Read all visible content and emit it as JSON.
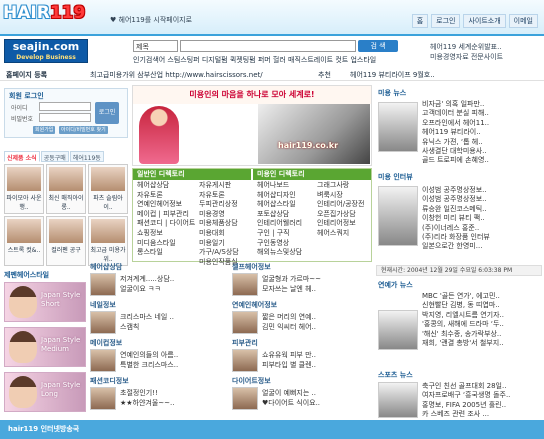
{
  "header": {
    "logo_prefix": "HAIR",
    "logo_suffix": "119",
    "start_link": "♥ 헤어119를 시작페이지로",
    "links": [
      "홈",
      "로그인",
      "사이트소개",
      "이메일"
    ]
  },
  "site": {
    "name": "seajin.com",
    "tagline": "Develop Business"
  },
  "search": {
    "select": "제목",
    "button": "검 색",
    "keywords": "인기검색어 스팀스팅퍼 디지털펌 퀵젯팅펌 퍼머 헐러 매직스트레이트 컷트 업스타일",
    "right_links": [
      "헤어119 세계순위발표..",
      "미용경영자료 전문사이트"
    ]
  },
  "nav": {
    "home": "홈페이지 등록",
    "items": [
      "최고급미용가위 삼부산업 http://www.hairscissors.net/",
      "추천",
      "헤어119 뷰티라이프 9월호.."
    ]
  },
  "login": {
    "title": "회원 로그인",
    "id_label": "아이디",
    "pw_label": "비밀번호",
    "button": "로그인",
    "small": [
      "회원가입",
      "아이디/비밀번호 찾기"
    ]
  },
  "tabs": [
    "신제품 소식",
    "공동구매",
    "헤어119동"
  ],
  "thumbs": [
    "파이모아 사운행..",
    "최신 매직아이롱..",
    "파츠 슬림아이..",
    "스트록 컷&..",
    "컬러펜 공구",
    "최고급 미용가위.."
  ],
  "style": {
    "title": "제펜헤어스타일",
    "items": [
      "Japan Style Short",
      "Japan Style Medium",
      "Japan Style Long"
    ]
  },
  "banner": {
    "text": "미용인의 마음을 하나로 모아 세계로!",
    "url": "hair119.co.kr"
  },
  "directory": {
    "head1": "일반인 디렉토리",
    "head2": "미용인 디렉토리",
    "col1": [
      "헤어샵상담",
      "자유토론",
      "연예인헤어정보",
      "메이컵 | 피부관리",
      "패션코디 | 다이어트",
      "쇼핑정보",
      "미디움스타일",
      "롱스타일"
    ],
    "col2": [
      "자유게시판",
      "자유토론",
      "두피관리상정",
      "미용경영",
      "미용체품상담",
      "미용대회",
      "미용일기",
      "가구/A/S상담",
      "미용인작품실"
    ],
    "col3": [
      "헤어나보드",
      "헤어샵디자인",
      "헤어샵스타일",
      "포토샵상담",
      "인테리어웰러리",
      "구인 | 구직",
      "구인동영상",
      "해외뉴스및상담"
    ],
    "col4": [
      "그래그사랑",
      "벼룩시장",
      "인테리어/공장전",
      "오픈집가상담",
      "인테리어정보",
      "헤어스쿼지"
    ]
  },
  "categories": [
    {
      "title": "헤어샵상담",
      "lines": [
        "저겨계계.....상담..",
        "얼굴이요 ㅋㅋ"
      ]
    },
    {
      "title": "셀프헤어정보",
      "lines": [
        "얼굴형과 가르마~~",
        "모자쓰는 날엔 헤.."
      ]
    },
    {
      "title": "네일정보",
      "lines": [
        "크리스마스 네일 ..",
        "스캠칙"
      ]
    },
    {
      "title": "연예인헤어정보",
      "lines": [
        "짧은 머리의 연예..",
        "김민 익씨터 헤어.."
      ]
    },
    {
      "title": "메이컵정보",
      "lines": [
        "연예인의들의 아름..",
        "특별한 크리스마스.."
      ]
    },
    {
      "title": "피부관리",
      "lines": [
        "쇼유유웍 피부 만..",
        "피부타입 별 클렌.."
      ]
    },
    {
      "title": "패션코디정보",
      "lines": [
        "초절정인기!!",
        "★★하얀겨울~~.."
      ]
    },
    {
      "title": "다이어트정보",
      "lines": [
        "얼굴이 예뻐지는 ..",
        "♥다이어트 식이요.."
      ]
    }
  ],
  "news": {
    "title": "미용 뉴스",
    "items": [
      "비자금' 의혹 일파만..",
      "고객데이터 분실 피해..",
      "오프라인에서 헤어11..",
      "헤어119 뷰티라이..",
      "유닉스 가젼, ‘톱 헤..",
      "사생결단 대학미용사..",
      "골드 트로피에 손혜영.."
    ]
  },
  "interview": {
    "title": "미용 인터뷰",
    "items": [
      "이성범 공주명상정보..",
      "이성범 공주명상정보..",
      "류승완 일진코스메틱..",
      "이창헌 미리 뷰티 팩..",
      "(주)이너레스 홍준..",
      "(주)리라 화장품 인터뷰",
      "일본으로간 한영미..."
    ]
  },
  "clock": "현재시간: 2004년 12월 29일 수요일 6:03:38 PM",
  "entertain": {
    "title": "연예가 뉴스",
    "items": [
      "MBC '골든 연가', 에고민..",
      "신현빨단 김병, 동 띠엽마..",
      "박지영, 리엘시트름 연기자..",
      "'홍콩의, 새해에 드라마 ‘두..",
      "'해신' 최수종, 송가락부상..",
      "재희, '괜결 총방'서 철부지.."
    ]
  },
  "sports": {
    "title": "스포츠 뉴스",
    "items": [
      "축구인 친선 골프대회 28일..",
      "여자프로배구 ‘흥국생명 돌주..",
      "홍명보, FIFA 2005년 훌린..",
      "카 스베즈 관련 조사 ..."
    ]
  },
  "footer": "hair119 인터넷방송국"
}
